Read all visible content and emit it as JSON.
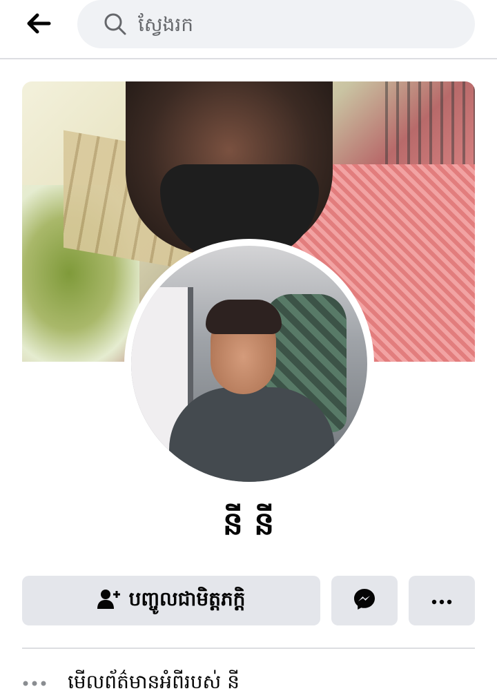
{
  "search": {
    "placeholder": "ស្វែងរក"
  },
  "profile": {
    "name": "នី នី"
  },
  "actions": {
    "add_friend_label": "បញ្ចូលជាមិត្តភក្តិ"
  },
  "about": {
    "label": "មើលព័ត៌មានអំពីរបស់ នី"
  },
  "colors": {
    "button_bg": "#e4e6eb",
    "search_bg": "#f0f2f5",
    "text_primary": "#050505",
    "text_secondary": "#65676b",
    "divider": "#dcdde1"
  }
}
